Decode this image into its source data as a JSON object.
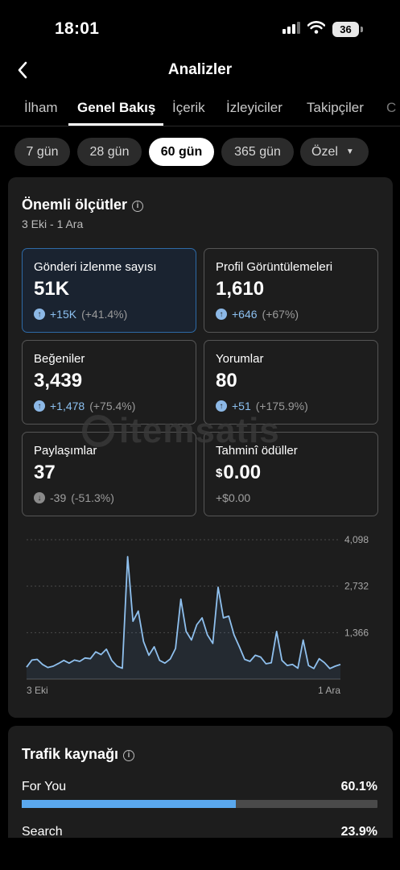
{
  "status": {
    "time": "18:01",
    "battery": "36"
  },
  "header": {
    "title": "Analizler"
  },
  "tabs": [
    {
      "label": "İlham",
      "active": false
    },
    {
      "label": "Genel Bakış",
      "active": true
    },
    {
      "label": "İçerik",
      "active": false
    },
    {
      "label": "İzleyiciler",
      "active": false
    },
    {
      "label": "Takipçiler",
      "active": false
    }
  ],
  "periods": [
    {
      "label": "7 gün",
      "active": false
    },
    {
      "label": "28 gün",
      "active": false
    },
    {
      "label": "60 gün",
      "active": true
    },
    {
      "label": "365 gün",
      "active": false
    },
    {
      "label": "Özel",
      "active": false
    }
  ],
  "key_metrics": {
    "title": "Önemli ölçütler",
    "date_range": "3 Eki - 1 Ara",
    "items": [
      {
        "label": "Gönderi izlenme sayısı",
        "value": "51K",
        "change": "+15K",
        "pct": "(+41.4%)",
        "direction": "up"
      },
      {
        "label": "Profil Görüntülemeleri",
        "value": "1,610",
        "change": "+646",
        "pct": "(+67%)",
        "direction": "up"
      },
      {
        "label": "Beğeniler",
        "value": "3,439",
        "change": "+1,478",
        "pct": "(+75.4%)",
        "direction": "up"
      },
      {
        "label": "Yorumlar",
        "value": "80",
        "change": "+51",
        "pct": "(+175.9%)",
        "direction": "up"
      },
      {
        "label": "Paylaşımlar",
        "value": "37",
        "change": "-39",
        "pct": "(-51.3%)",
        "direction": "down"
      },
      {
        "label": "Tahminî ödüller",
        "value_symbol": "$",
        "value": "0.00",
        "change": "+$0.00",
        "pct": "",
        "direction": "none"
      }
    ]
  },
  "watermark": "itemsatis",
  "chart_data": {
    "type": "line",
    "x_start_label": "3 Eki",
    "x_end_label": "1 Ara",
    "y_tick_labels": [
      "4,098",
      "2,732",
      "1,366"
    ],
    "ylim": [
      0,
      4098
    ],
    "line_color": "#8fc0ee",
    "grid": true,
    "series": [
      {
        "values": [
          350,
          560,
          580,
          430,
          340,
          380,
          460,
          550,
          470,
          560,
          520,
          620,
          600,
          800,
          720,
          880,
          550,
          380,
          320,
          3600,
          1700,
          2000,
          1100,
          700,
          950,
          550,
          470,
          590,
          900,
          2350,
          1400,
          1150,
          1600,
          1800,
          1300,
          1050,
          2700,
          1800,
          1850,
          1300,
          950,
          580,
          520,
          700,
          650,
          450,
          480,
          1400,
          550,
          400,
          430,
          320,
          1150,
          400,
          310,
          600,
          480,
          310,
          380,
          430
        ]
      }
    ]
  },
  "traffic": {
    "title": "Trafik kaynağı",
    "items": [
      {
        "label": "For You",
        "value": "60.1%",
        "fraction": 0.601
      },
      {
        "label": "Search",
        "value": "23.9%",
        "fraction": 0.239
      }
    ]
  }
}
